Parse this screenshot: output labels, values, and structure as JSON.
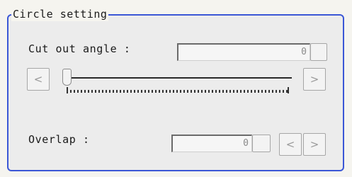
{
  "group": {
    "title": "Circle setting"
  },
  "cut_out_angle": {
    "label": "Cut out angle :",
    "value": "0",
    "slider_value": 0
  },
  "overlap": {
    "label": "Overlap :",
    "value": "0"
  },
  "icons": {
    "decrement": "<",
    "increment": ">"
  }
}
